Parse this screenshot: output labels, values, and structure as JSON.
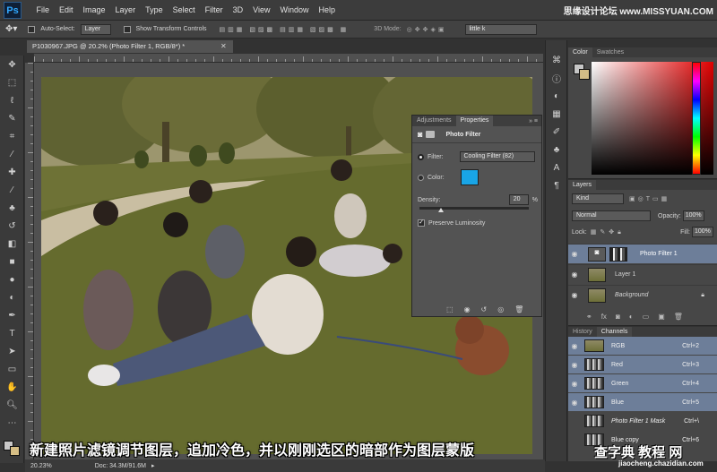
{
  "app": {
    "logo": "Ps",
    "menus": [
      "File",
      "Edit",
      "Image",
      "Layer",
      "Type",
      "Select",
      "Filter",
      "3D",
      "View",
      "Window",
      "Help"
    ],
    "watermark_top": "思缘设计论坛 www.MISSYUAN.COM"
  },
  "options_bar": {
    "auto_select_label": "Auto-Select:",
    "auto_select_value": "Layer",
    "transform_label": "Show Transform Controls",
    "mode_label": "3D Mode:",
    "workspace": "little k"
  },
  "document": {
    "tab_title": "P1030967.JPG @ 20.2% (Photo Filter 1, RGB/8*) *",
    "zoom": "20.23%",
    "doc_info": "Doc: 34.3M/91.6M"
  },
  "adjustments_panel": {
    "tab_adjustments": "Adjustments",
    "tab_properties": "Properties",
    "title": "Photo Filter",
    "filter_label": "Filter:",
    "filter_value": "Cooling Filter (82)",
    "color_label": "Color:",
    "color_swatch": "#19a5e6",
    "density_label": "Density:",
    "density_value": "20",
    "density_unit": "%",
    "density_fraction": 0.2,
    "preserve_label": "Preserve Luminosity"
  },
  "color_panel": {
    "tab_color": "Color",
    "tab_swatches": "Swatches"
  },
  "layers_panel": {
    "tab": "Layers",
    "kind": "Kind",
    "blend_mode": "Normal",
    "opacity_label": "Opacity:",
    "opacity_value": "100%",
    "lock_label": "Lock:",
    "fill_label": "Fill:",
    "fill_value": "100%",
    "layers": [
      {
        "name": "Photo Filter 1",
        "selected": true
      },
      {
        "name": "Layer 1",
        "selected": false
      },
      {
        "name": "Background",
        "selected": false
      }
    ]
  },
  "channels_panel": {
    "tab_history": "History",
    "tab_channels": "Channels",
    "channels": [
      {
        "name": "RGB",
        "shortcut": "Ctrl+2"
      },
      {
        "name": "Red",
        "shortcut": "Ctrl+3"
      },
      {
        "name": "Green",
        "shortcut": "Ctrl+4"
      },
      {
        "name": "Blue",
        "shortcut": "Ctrl+5"
      },
      {
        "name": "Photo Filter 1 Mask",
        "shortcut": "Ctrl+\\"
      },
      {
        "name": "Blue copy",
        "shortcut": "Ctrl+6"
      }
    ]
  },
  "caption": "新建照片滤镜调节图层，追加冷色，并以刚刚选区的暗部作为图层蒙版",
  "watermark_bottom": "查字典 教程 网",
  "watermark_url": "jiaocheng.chazidian.com"
}
